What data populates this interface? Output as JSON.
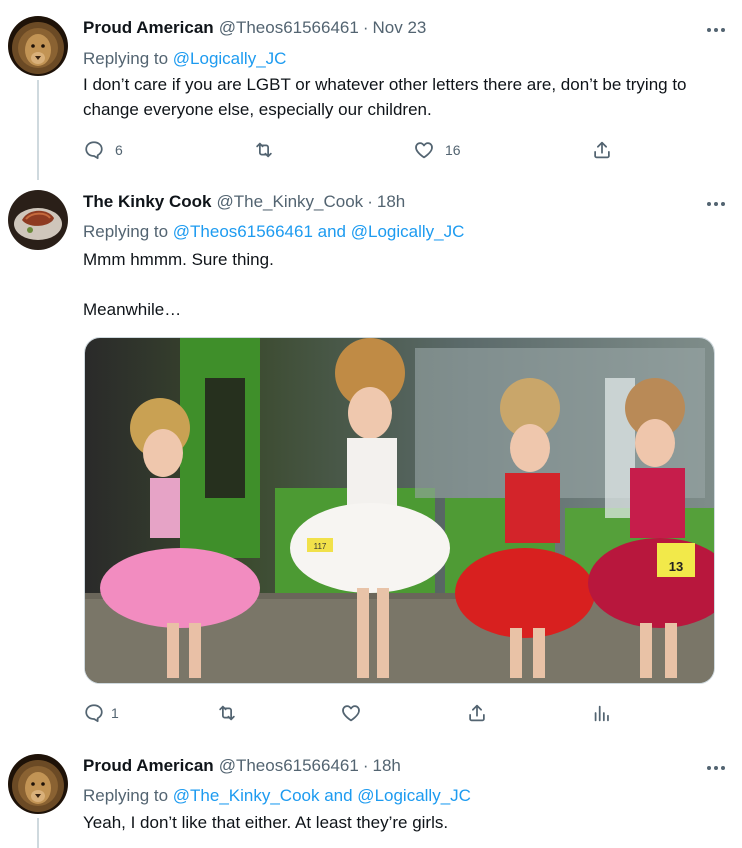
{
  "tweets": [
    {
      "name": "Proud American",
      "handle": "@Theos61566461",
      "sep": "·",
      "time": "Nov 23",
      "replying_prefix": "Replying to ",
      "replying_to": "@Logically_JC",
      "text": "I don’t care if you are LGBT or whatever other letters there are, don’t be trying to change everyone else, especially our children.",
      "replies": "6",
      "retweets": "",
      "likes": "16",
      "avatar_icon": "lion-avatar"
    },
    {
      "name": "The Kinky Cook",
      "handle": "@The_Kinky_Cook",
      "sep": "·",
      "time": "18h",
      "replying_prefix": "Replying to ",
      "replying_to": "@Theos61566461 and @Logically_JC",
      "text": "Mmm hmmm. Sure thing.\n\nMeanwhile…",
      "replies": "1",
      "retweets": "",
      "likes": "",
      "avatar_icon": "food-avatar",
      "media_icon": "pageant-photo"
    },
    {
      "name": "Proud American",
      "handle": "@Theos61566461",
      "sep": "·",
      "time": "18h",
      "replying_prefix": "Replying to ",
      "replying_to": "@The_Kinky_Cook and @Logically_JC",
      "text": "Yeah, I don’t like that either. At least they’re girls.",
      "avatar_icon": "lion-avatar"
    }
  ],
  "photo": {
    "tag_left": "117",
    "tag_right": "13"
  },
  "colors": {
    "accent": "#1d9bf0",
    "secondary_text": "#536471",
    "primary_text": "#0f1419",
    "thread_line": "#cfd9de"
  }
}
